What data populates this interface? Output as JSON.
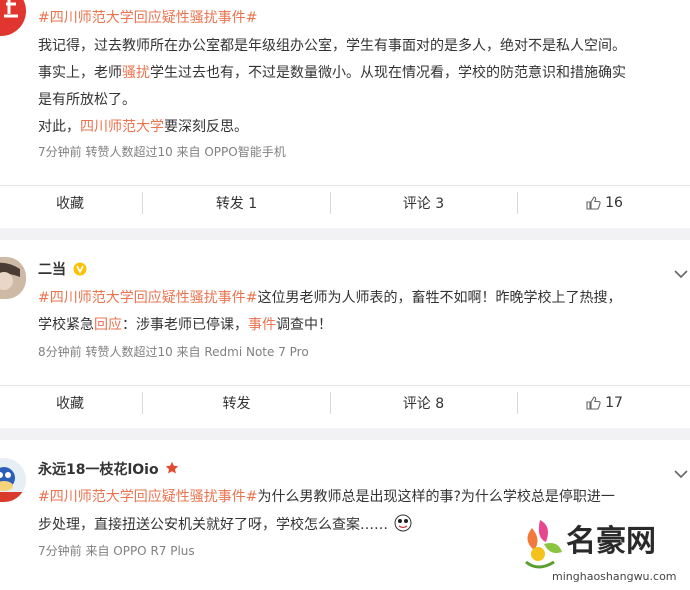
{
  "posts": [
    {
      "hashtag": "#四川师范大学回应疑性骚扰事件#",
      "line1": "我记得，过去教师所在办公室都是年级组办公室，学生有事面对的是多人，绝对不是私人空间。",
      "line2_a": "事实上，老师",
      "line2_link": "骚扰",
      "line2_b": "学生过去也有，不过是数量微小。从现在情况看，学校的防范意识和措施确实",
      "line3": "是有所放松了。",
      "line4_a": "对此，",
      "line4_link": "四川师范大学",
      "line4_b": "要深刻反思。",
      "meta": "7分钟前  转赞人数超过10  来自 OPPO智能手机",
      "actions": {
        "fav": "收藏",
        "forward": "转发 1",
        "comment": "评论 3",
        "like": "16"
      }
    },
    {
      "username": "二当",
      "hashtag": "#四川师范大学回应疑性骚扰事件#",
      "line1_b": "这位男老师为人师表的，畜牲不如啊！昨晚学校上了热搜，",
      "line2_a": "学校紧急",
      "line2_link1": "回应",
      "line2_b": "：涉事老师已停课，",
      "line2_link2": "事件",
      "line2_c": "调查中！",
      "meta": "8分钟前  转赞人数超过10  来自 Redmi Note 7 Pro",
      "actions": {
        "fav": "收藏",
        "forward": "转发",
        "comment": "评论 8",
        "like": "17"
      }
    },
    {
      "username": "永远18一枝花lOio",
      "hashtag": "#四川师范大学回应疑性骚扰事件#",
      "line1_b": "为什么男教师总是出现这样的事?为什么学校总是停职进一",
      "line2": "步处理，直接扭送公安机关就好了呀，学校怎么查案……",
      "meta": "7分钟前  来自 OPPO R7 Plus"
    }
  ],
  "watermark": {
    "brand": "名豪网",
    "url": "minghaoshangwu.com"
  },
  "colors": {
    "link": "#eb7350",
    "badge": "#ffc000",
    "star": "#e34b2f"
  }
}
